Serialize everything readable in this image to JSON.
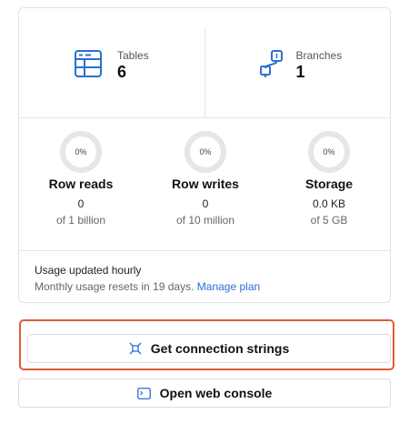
{
  "stats": {
    "tables": {
      "label": "Tables",
      "value": "6",
      "icon": "table-icon"
    },
    "branches": {
      "label": "Branches",
      "value": "1",
      "icon": "branch-icon"
    }
  },
  "usage": {
    "row_reads": {
      "pct": "0%",
      "title": "Row reads",
      "value": "0",
      "cap": "of 1 billion",
      "fraction": 0
    },
    "row_writes": {
      "pct": "0%",
      "title": "Row writes",
      "value": "0",
      "cap": "of 10 million",
      "fraction": 0
    },
    "storage": {
      "pct": "0%",
      "title": "Storage",
      "value": "0.0 KB",
      "cap": "of 5 GB",
      "fraction": 0
    }
  },
  "footer": {
    "updated": "Usage updated hourly",
    "resets": "Monthly usage resets in 19 days.",
    "manage_plan": "Manage plan"
  },
  "buttons": {
    "connection": {
      "label": "Get connection strings",
      "icon": "connect-icon"
    },
    "console": {
      "label": "Open web console",
      "icon": "terminal-icon"
    }
  },
  "colors": {
    "accent_link": "#2a6fd6",
    "highlight": "#e35a3a",
    "icon_blue": "#2b6fd1"
  }
}
